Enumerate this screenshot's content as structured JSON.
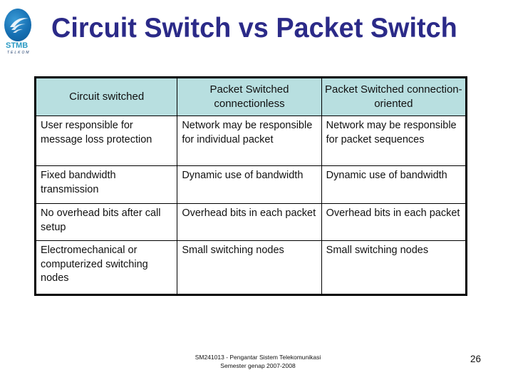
{
  "slide": {
    "title": "Circuit Switch vs Packet Switch",
    "logo": {
      "text": "STMB",
      "subtext": "TELKOM",
      "icon": "stmb-telkom-logo-icon"
    },
    "table": {
      "headers": [
        "Circuit switched",
        "Packet Switched connectionless",
        "Packet Switched connection-oriented"
      ],
      "rows": [
        [
          "User responsible for message loss protection",
          "Network may be responsible for individual packet",
          "Network may be responsible for packet sequences"
        ],
        [
          "Fixed bandwidth transmission",
          "Dynamic use of bandwidth",
          "Dynamic use of bandwidth"
        ],
        [
          "No overhead bits after call setup",
          "Overhead bits in each packet",
          "Overhead bits in each packet"
        ],
        [
          "Electromechanical or computerized switching nodes",
          "Small switching nodes",
          "Small switching nodes"
        ]
      ],
      "header_color": "#b8dfe0"
    },
    "footer": {
      "line1": "SM241013 - Pengantar Sistem Telekomunikasi",
      "line2": "Semester genap 2007-2008"
    },
    "page_number": "26",
    "colors": {
      "title": "#2b2a88",
      "logo_blue": "#1670b3",
      "logo_text": "#2a9ac4"
    }
  }
}
